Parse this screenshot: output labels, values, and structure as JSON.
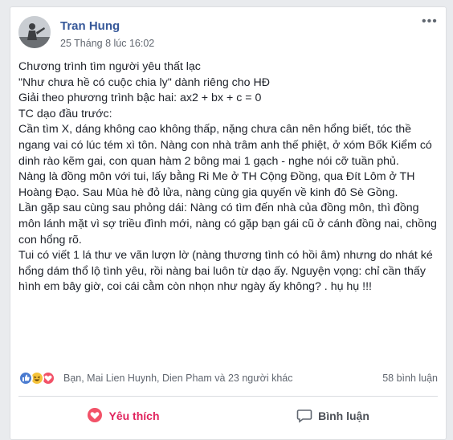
{
  "post": {
    "author": "Tran Hung",
    "timestamp": "25 Tháng 8 lúc 16:02",
    "lines": [
      "Chương trình tìm người yêu thất lạc",
      "\"Như chưa hề có cuộc chia ly\" dành riêng cho HĐ",
      "Giải theo phương trình bậc hai: ax2 + bx + c = 0",
      "TC dạo đầu trước:",
      "Cần tìm X, dáng không cao không thấp, nặng chưa cân nên hổng biết, tóc thề ngang vai có lúc tém xì tôn. Nàng con nhà trâm anh thế phiệt, ở xóm Bốk Kiểm có dinh rào kẽm gai, con quan hàm 2 bông mai 1 gạch - nghe nói cỡ tuần phủ.",
      "Nàng là đồng môn với tui, lấy bằng Ri Me ở TH Cộng Đồng, qua Đít Lôm ở TH Hoàng Đạo. Sau Mùa hè đỏ lửa, nàng cùng gia quyến về kinh đô Sè Gồng.",
      "Lần gặp sau cùng sau phỏng dái: Nàng có tìm đến nhà của đồng môn, thì đồng môn lánh mặt vì sợ triều đình mới, nàng có gặp bạn gái cũ ở cánh đồng nai, chồng con hổng rõ.",
      "Tui có viết 1 lá thư ve vãn lượn lờ (nàng thương tình có hồi âm) nhưng do nhát ké hổng dám thổ lộ tình yêu, rồi nàng bai luôn từ dạo ấy. Nguyện vọng: chỉ cần thấy hình em bây giờ, coi cái cằm còn nhọn như ngày ấy không? . hụ hụ !!!"
    ]
  },
  "reactions": {
    "icons": [
      "like-icon",
      "haha-icon",
      "love-icon"
    ],
    "colors": {
      "like": "#4a7bd0",
      "haha": "#f5c33b",
      "love": "#f25268"
    },
    "names": "Bạn, Mai Lien Huynh, Dien Pham và 23 người khác",
    "comments": "58 bình luận"
  },
  "actions": {
    "like_label": "Yêu thích",
    "comment_label": "Bình luận"
  }
}
